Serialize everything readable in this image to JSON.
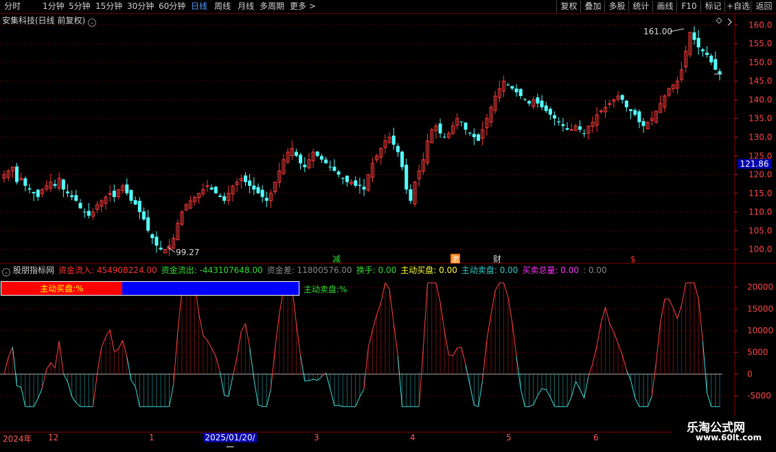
{
  "toolbar": {
    "left_items": [
      "分时",
      "1分钟",
      "5分钟",
      "15分钟",
      "30分钟",
      "60分钟",
      "日线",
      "周线",
      "月线",
      "多周期",
      "更多 >"
    ],
    "active_item": "日线",
    "right_items": [
      "复权",
      "叠加",
      "多股",
      "统计",
      "画线",
      "F10",
      "标记",
      "+自选",
      "返回"
    ]
  },
  "chart_title": "安集科技(日线 前复权)",
  "price_axis": [
    "160.0",
    "155.0",
    "150.0",
    "145.0",
    "140.0",
    "135.0",
    "130.0",
    "125.0",
    "120.0",
    "115.0",
    "110.0",
    "105.0",
    "100.0"
  ],
  "current_price_tag": "121.86",
  "annotations": {
    "high_label": "161.00",
    "low_label": "99.27"
  },
  "markers": [
    {
      "text": "减",
      "color": "#33dd33"
    },
    {
      "text": "激",
      "color": "#ff9900"
    },
    {
      "text": "财",
      "color": "#dddddd"
    },
    {
      "text": "$",
      "color": "#ff3333"
    }
  ],
  "indicator": {
    "name": "股朋指标网",
    "items": [
      {
        "label": "资金流入:",
        "value": "454908224.00",
        "color": "#ff3333"
      },
      {
        "label": "资金流出:",
        "value": "-443107648.00",
        "color": "#33dd33"
      },
      {
        "label": "资金差:",
        "value": "11800576.00",
        "color": "#888888"
      },
      {
        "label": "换手:",
        "value": "0.00",
        "color": "#33dd33"
      },
      {
        "label": "主动买盘:",
        "value": "0.00",
        "color": "#ffff33"
      },
      {
        "label": "主动卖盘:",
        "value": "0.00",
        "color": "#33cccc"
      },
      {
        "label": "买卖总量:",
        "value": "0.00",
        "color": "#ff33ff"
      },
      {
        "label": ":",
        "value": "0.00",
        "color": "#888888"
      }
    ],
    "buy_label": "主动买盘:%",
    "sell_label": "主动卖盘:%",
    "axis": [
      "20000",
      "15000",
      "10000",
      "5000",
      "0",
      "-5000"
    ]
  },
  "date_axis": [
    {
      "text": "2024年"
    },
    {
      "text": "12"
    },
    {
      "text": "1"
    },
    {
      "text": "3"
    },
    {
      "text": "4"
    },
    {
      "text": "5"
    },
    {
      "text": "6"
    }
  ],
  "date_cursor": "2025/01/20/一",
  "watermark": {
    "line1": "乐淘公式网",
    "line2": "www.60lt.com"
  },
  "chart_data": {
    "type": "candlestick",
    "title": "安集科技(日线 前复权)",
    "ylim": [
      97,
      163
    ],
    "key_prices": {
      "high": 161.0,
      "low": 99.27,
      "last": 121.86
    },
    "close_series": [
      120,
      121,
      122,
      118,
      119,
      117,
      116,
      115,
      114,
      116,
      117,
      118,
      117,
      119,
      116,
      115,
      114,
      113,
      111,
      110,
      109,
      110,
      112,
      113,
      114,
      115,
      114,
      116,
      117,
      115,
      113,
      112,
      110,
      108,
      105,
      103,
      101,
      100,
      100,
      101,
      103,
      107,
      110,
      112,
      113,
      114,
      115,
      116,
      117,
      116,
      115,
      114,
      113,
      115,
      117,
      118,
      119,
      118,
      117,
      116,
      115,
      114,
      113,
      115,
      118,
      121,
      124,
      126,
      127,
      125,
      123,
      122,
      124,
      126,
      125,
      124,
      123,
      122,
      121,
      120,
      119,
      118,
      118,
      117,
      117,
      116,
      120,
      123,
      125,
      127,
      129,
      130,
      128,
      126,
      122,
      116,
      113,
      118,
      121,
      124,
      129,
      132,
      133,
      131,
      130,
      131,
      133,
      135,
      134,
      132,
      131,
      130,
      129,
      132,
      135,
      138,
      141,
      143,
      145,
      144,
      143,
      142,
      141,
      140,
      139,
      140,
      139,
      138,
      137,
      136,
      135,
      134,
      133,
      132,
      132,
      133,
      132,
      131,
      133,
      134,
      136,
      137,
      138,
      139,
      140,
      141,
      140,
      138,
      137,
      136,
      134,
      133,
      134,
      135,
      137,
      139,
      141,
      143,
      144,
      145,
      148,
      153,
      158,
      156,
      154,
      153,
      152,
      150,
      148,
      147
    ]
  }
}
